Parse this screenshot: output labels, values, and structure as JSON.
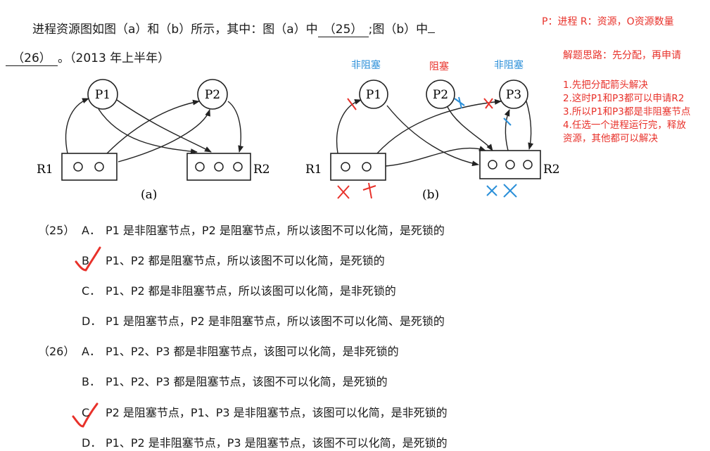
{
  "question": {
    "intro": "进程资源图如图（a）和（b）所示，其中：图（a）中",
    "blank25": "（25）",
    "mid": ";图（b）中",
    "blank26": "（26）",
    "tail": "。（2013 年上半年）"
  },
  "figure": {
    "a": {
      "caption": "(a)",
      "p1": "P1",
      "p2": "P2",
      "r1": "R1",
      "r2": "R2",
      "r1_units": [
        "O",
        "O"
      ],
      "r2_units": [
        "O",
        "O",
        "O"
      ]
    },
    "b": {
      "caption": "(b)",
      "p1": "P1",
      "p2": "P2",
      "p3": "P3",
      "r1": "R1",
      "r2": "R2",
      "r1_units": [
        "O",
        "O"
      ],
      "r2_units": [
        "O",
        "O",
        "O"
      ],
      "label_p1": "非阻塞",
      "label_p2": "阻塞",
      "label_p3": "非阻塞"
    }
  },
  "q25": {
    "num": "（25）",
    "options": [
      {
        "label": "A．",
        "text": "P1 是非阻塞节点，P2 是阻塞节点，所以该图不可以化简，是死锁的"
      },
      {
        "label": "B",
        "text": "P1、P2 都是阻塞节点，所以该图不可以化简，是死锁的"
      },
      {
        "label": "C．",
        "text": "P1、P2 都是非阻塞节点，所以该图可以化简，是非死锁的"
      },
      {
        "label": "D．",
        "text": "P1 是阻塞节点，P2 是非阻塞节点，所以该图不可以化简、是死锁的"
      }
    ]
  },
  "q26": {
    "num": "（26）",
    "options": [
      {
        "label": "A．",
        "text": "P1、P2、P3 都是非阻塞节点，该图可以化简，是非死锁的"
      },
      {
        "label": "B．",
        "text": "P1、P2、P3 都是阻塞节点，该图不可以化简，是死锁的"
      },
      {
        "label": "C",
        "text": "P2 是阻塞节点，P1、P3 是非阻塞节点，该图可以化简，是非死锁的"
      },
      {
        "label": "D．",
        "text": "P1、P2 是非阻塞节点，P3 是阻塞节点，该图不可以化简，是死锁的"
      }
    ]
  },
  "notes": {
    "legend": "P：进程  R：资源，O资源数量",
    "idea": "解题思路：先分配，再申请",
    "steps": [
      "1.先把分配箭头解决",
      "2.这时P1和P3都可以申请R2",
      "3.所以P1和P3都是非阻塞节点",
      "4.任选一个进程运行完，释放",
      "资源，其他都可以解决"
    ]
  },
  "colors": {
    "annotation_red": "#e8312a",
    "annotation_blue": "#2b8fd9",
    "text": "#1a1a1a"
  }
}
